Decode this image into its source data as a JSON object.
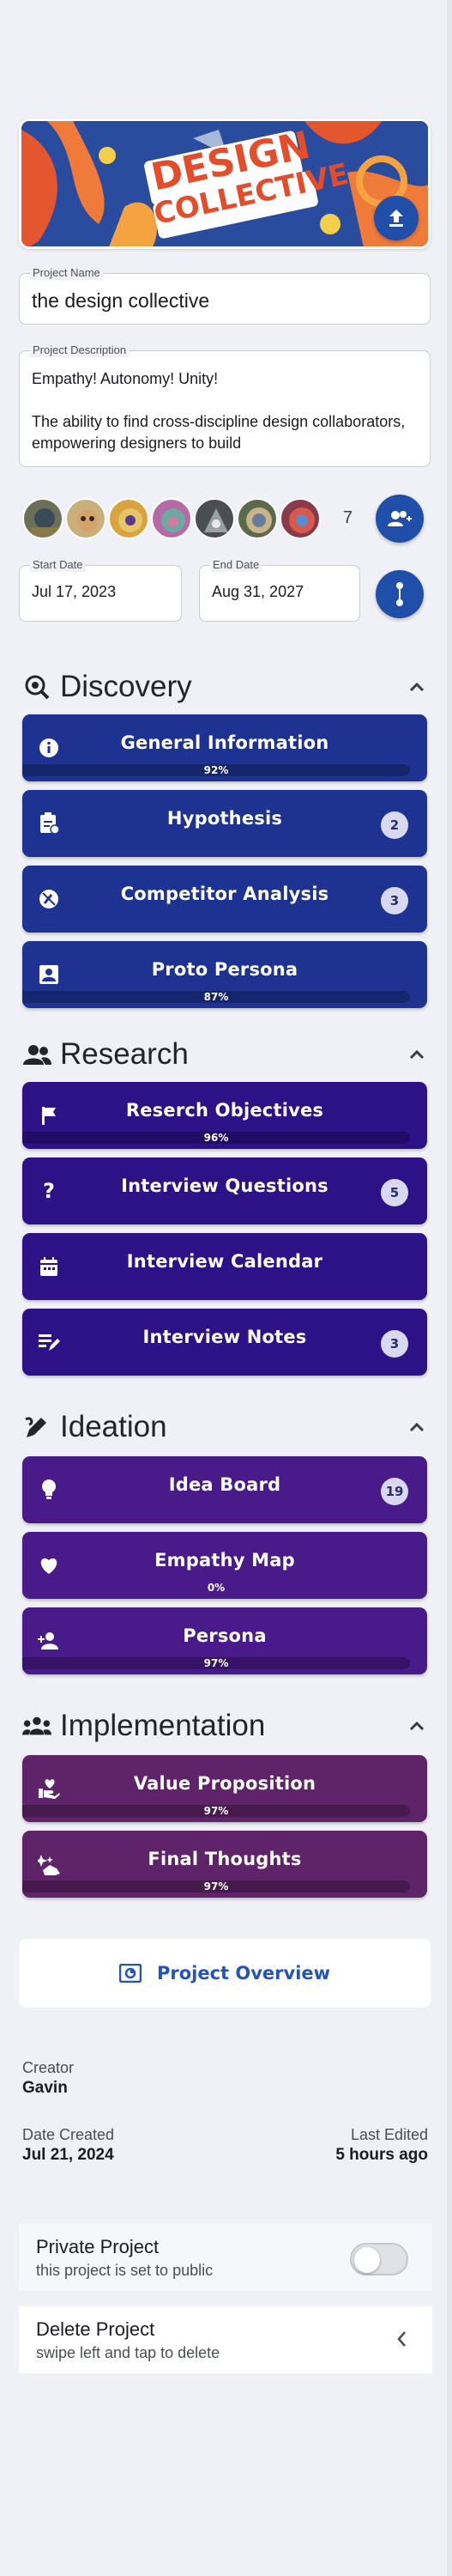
{
  "project": {
    "banner_text_line1": "DESIGN",
    "banner_text_line2": "COLLECTIVE",
    "name_label": "Project Name",
    "name_value": "the design collective",
    "description_label": "Project Description",
    "description_value": "Empathy! Autonomy! Unity!\n\nThe ability to find cross-discipline design collaborators, empowering designers to build",
    "member_count": "7",
    "start_label": "Start Date",
    "start_value": "Jul 17, 2023",
    "end_label": "End Date",
    "end_value": "Aug 31, 2027"
  },
  "sections": {
    "discovery": {
      "title": "Discovery",
      "items": [
        {
          "label": "General Information",
          "progress": "92%",
          "progress_value": 0.92,
          "icon": "info-icon"
        },
        {
          "label": "Hypothesis",
          "badge": "2",
          "icon": "clipboard-icon"
        },
        {
          "label": "Competitor Analysis",
          "badge": "3",
          "icon": "no-pencil-icon"
        },
        {
          "label": "Proto Persona",
          "progress": "87%",
          "progress_value": 0.87,
          "icon": "badge-icon"
        }
      ]
    },
    "research": {
      "title": "Research",
      "items": [
        {
          "label": "Reserch Objectives",
          "progress": "96%",
          "progress_value": 0.96,
          "icon": "flag-icon"
        },
        {
          "label": "Interview Questions",
          "badge": "5",
          "icon": "question-icon"
        },
        {
          "label": "Interview Calendar",
          "icon": "calendar-icon"
        },
        {
          "label": "Interview Notes",
          "badge": "3",
          "icon": "notes-icon"
        }
      ]
    },
    "ideation": {
      "title": "Ideation",
      "items": [
        {
          "label": "Idea Board",
          "badge": "19",
          "icon": "lightbulb-icon"
        },
        {
          "label": "Empathy Map",
          "progress": "0%",
          "progress_value": 0.0,
          "icon": "heart-icon"
        },
        {
          "label": "Persona",
          "progress": "97%",
          "progress_value": 0.97,
          "icon": "person-add-icon"
        }
      ]
    },
    "implementation": {
      "title": "Implementation",
      "items": [
        {
          "label": "Value Proposition",
          "progress": "97%",
          "progress_value": 0.97,
          "icon": "hand-heart-icon"
        },
        {
          "label": "Final Thoughts",
          "progress": "97%",
          "progress_value": 0.97,
          "icon": "hand-sparkle-icon"
        }
      ]
    }
  },
  "overview": {
    "label": "Project Overview"
  },
  "meta": {
    "creator_label": "Creator",
    "creator_value": "Gavin",
    "created_label": "Date Created",
    "created_value": "Jul 21, 2024",
    "edited_label": "Last Edited",
    "edited_value": "5 hours ago"
  },
  "settings": {
    "private_title": "Private Project",
    "private_sub": "this project is set to public",
    "private_on": false,
    "delete_title": "Delete Project",
    "delete_sub": "swipe left and tap to delete"
  },
  "colors": {
    "accent": "#1f4fa8",
    "discovery": "#1e3391",
    "research": "#2c1187",
    "ideation": "#491a89",
    "implementation": "#5f2369"
  }
}
